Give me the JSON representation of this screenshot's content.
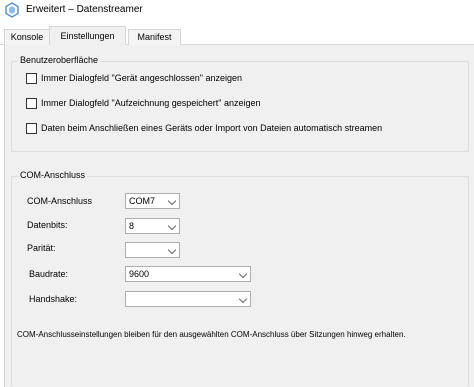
{
  "window": {
    "title": "Erweitert – Datenstreamer",
    "icon": "app-logo-icon"
  },
  "tabs": [
    {
      "label": "Konsole",
      "selected": false
    },
    {
      "label": "Einstellungen",
      "selected": true
    },
    {
      "label": "Manifest",
      "selected": false
    }
  ],
  "ui_group": {
    "title": "Benutzeroberfläche",
    "checkboxes": [
      {
        "label": "Immer Dialogfeld \"Gerät angeschlossen\" anzeigen",
        "checked": false
      },
      {
        "label": "Immer Dialogfeld \"Aufzeichnung gespeichert\" anzeigen",
        "checked": false
      },
      {
        "label": "Daten beim Anschließen eines Geräts oder Import von Dateien automatisch streamen",
        "checked": false
      }
    ]
  },
  "com_group": {
    "title": "COM-Anschluss",
    "fields": {
      "port": {
        "label": "COM-Anschluss",
        "value": "COM7"
      },
      "databits": {
        "label": "Datenbits:",
        "value": "8"
      },
      "parity": {
        "label": "Parität:",
        "value": ""
      },
      "baudrate": {
        "label": "Baudrate:",
        "value": "9600"
      },
      "handshake": {
        "label": "Handshake:",
        "value": ""
      }
    },
    "note": "COM-Anschlusseinstellungen bleiben für den ausgewählten COM-Anschluss über Sitzungen hinweg erhalten."
  }
}
